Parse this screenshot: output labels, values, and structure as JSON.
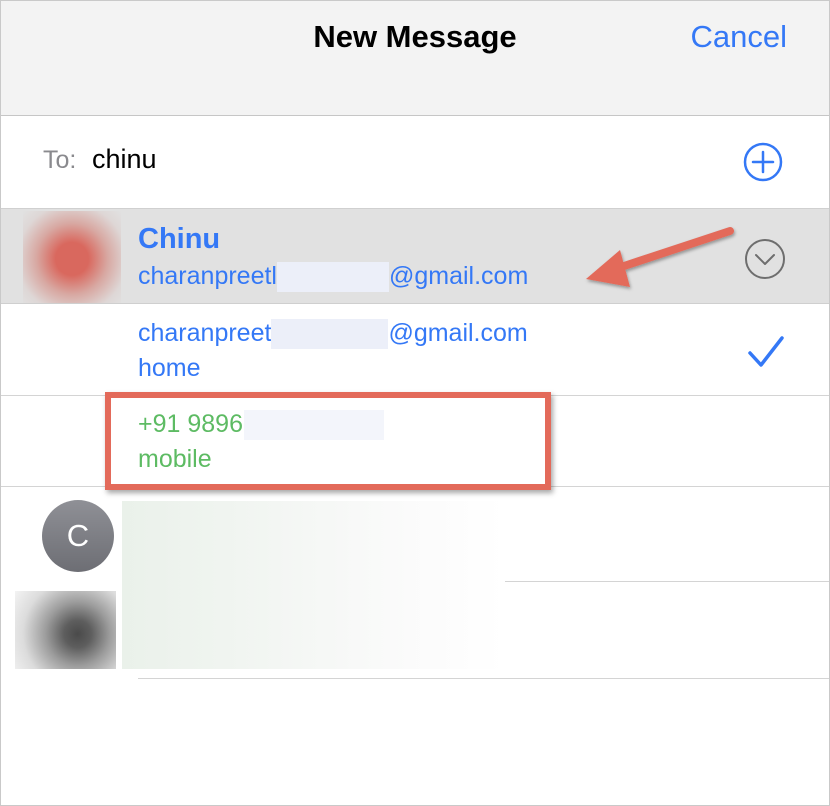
{
  "navbar": {
    "title": "New Message",
    "cancel_label": "Cancel"
  },
  "recipient": {
    "label": "To:",
    "value": "chinu"
  },
  "suggestion": {
    "name": "Chinu",
    "email_prefix": "charanpreetl",
    "email_suffix": "@gmail.com"
  },
  "alt_email": {
    "prefix": "charanpreet",
    "suffix": "@gmail.com",
    "label": "home"
  },
  "phone": {
    "number": "+91 9896:",
    "label": "mobile"
  },
  "contact_initial": "C",
  "icons": {
    "add": "plus-circle-icon",
    "disclosure": "chevron-down-circle-icon",
    "selected": "checkmark-icon"
  },
  "colors": {
    "accent": "#3478f6",
    "phone": "#5dbb63",
    "annotation": "#e36a5a"
  }
}
